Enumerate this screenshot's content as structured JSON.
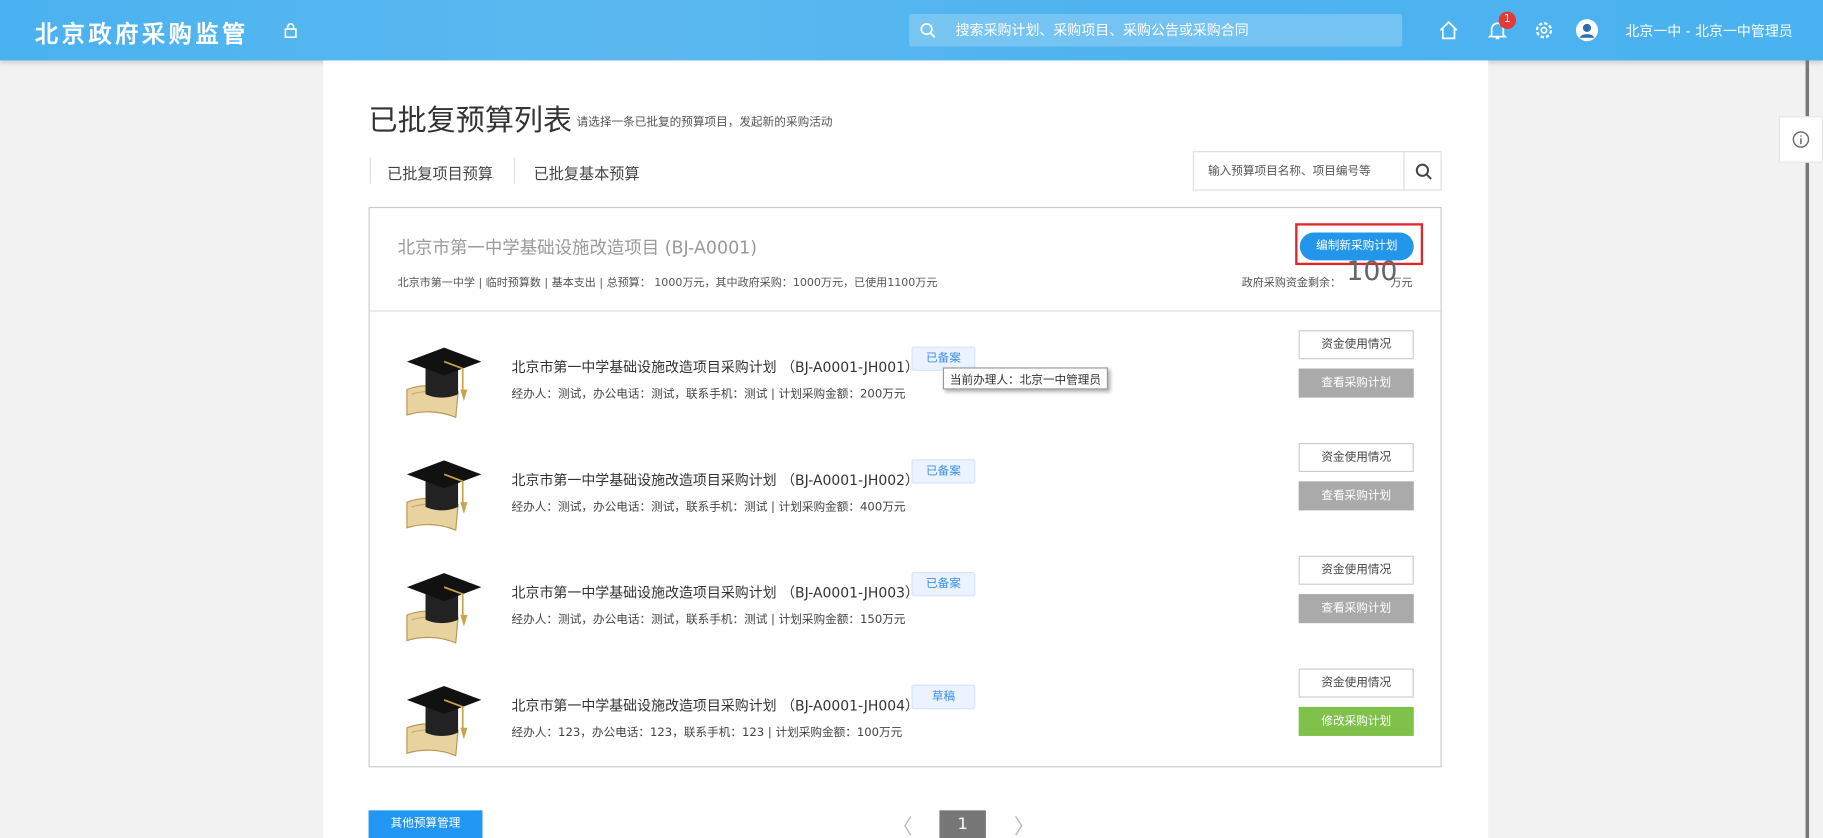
{
  "header": {
    "logo": "北京政府采购监管",
    "search_placeholder": "搜索采购计划、采购项目、采购公告或采购合同",
    "notification_count": "1",
    "user": "北京一中 - 北京一中管理员",
    "accent": "#4ab2f0"
  },
  "page": {
    "title": "已批复预算列表",
    "subtitle": "请选择一条已批复的预算项目，发起新的采购活动"
  },
  "tabs": [
    {
      "label": "已批复项目预算"
    },
    {
      "label": "已批复基本预算"
    }
  ],
  "search": {
    "placeholder": "输入预算项目名称、项目编号等"
  },
  "budget": {
    "title": "北京市第一中学基础设施改造项目 (BJ-A0001)",
    "meta": "北京市第一中学 | 临时预算数 | 基本支出 | 总预算：  1000万元，其中政府采购：1000万元，已使用1100万元",
    "new_plan_button": "编制新采购计划",
    "remaining_label": "政府采购资金剩余：",
    "remaining_value": "100",
    "remaining_unit": "万元"
  },
  "plans": [
    {
      "title": "北京市第一中学基础设施改造项目采购计划 （BJ-A0001-JH001）",
      "meta": "经办人：测试，办公电话：测试，联系手机：测试 | 计划采购金额：200万元",
      "status": "已备案",
      "btn1": "资金使用情况",
      "btn2": "查看采购计划"
    },
    {
      "title": "北京市第一中学基础设施改造项目采购计划 （BJ-A0001-JH002）",
      "meta": "经办人：测试，办公电话：测试，联系手机：测试 | 计划采购金额：400万元",
      "status": "已备案",
      "btn1": "资金使用情况",
      "btn2": "查看采购计划"
    },
    {
      "title": "北京市第一中学基础设施改造项目采购计划 （BJ-A0001-JH003）",
      "meta": "经办人：测试，办公电话：测试，联系手机：测试 | 计划采购金额：150万元",
      "status": "已备案",
      "btn1": "资金使用情况",
      "btn2": "查看采购计划"
    },
    {
      "title": "北京市第一中学基础设施改造项目采购计划 （BJ-A0001-JH004）",
      "meta": "经办人：123，办公电话：123，联系手机：123 | 计划采购金额：100万元",
      "status": "草稿",
      "btn1": "资金使用情况",
      "btn2": "修改采购计划"
    }
  ],
  "tooltip": "当前办理人：北京一中管理员",
  "footer": {
    "other_button": "其他预算管理",
    "current_page": "1",
    "prev": "〈",
    "next": "〉"
  }
}
